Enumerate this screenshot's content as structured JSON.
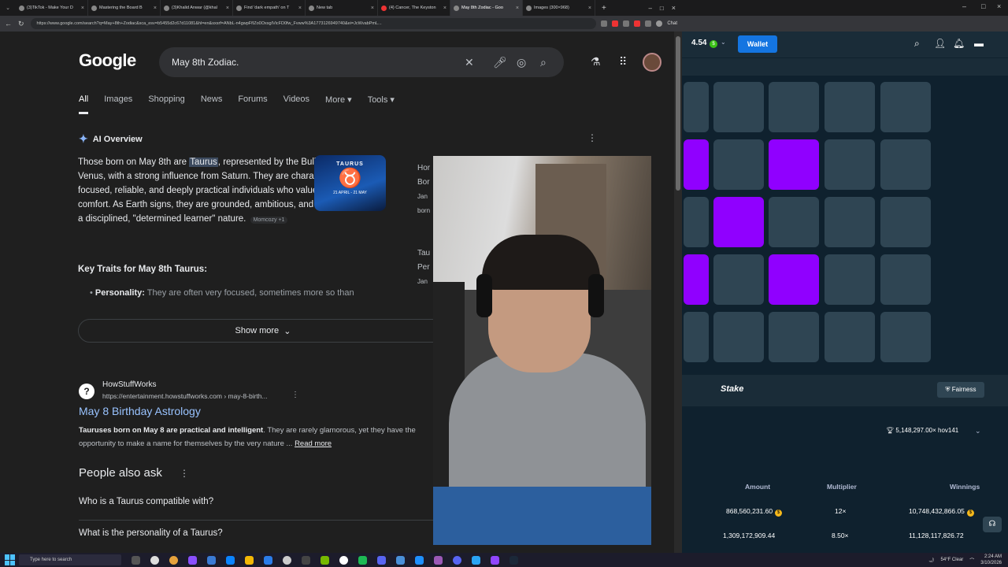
{
  "tabs": [
    {
      "label": "(3)TikTok - Make Your D"
    },
    {
      "label": "Mastering the Board B"
    },
    {
      "label": "(3)Khalid Anwar (@khal"
    },
    {
      "label": "Find 'dark empath' on T"
    },
    {
      "label": "New tab"
    },
    {
      "label": "(4) Cancer, The Keyston"
    },
    {
      "label": "May 8th Zodiac - Goo"
    },
    {
      "label": "Images (300×968)"
    }
  ],
  "address": {
    "url": "https://www.google.com/search?q=May+8th+Zodiac&sca_esv=b5455d2c67d11081&hl=en&sxsrf=ANbL-n4gwpFfIZo0OxsgIVicFD0fw_Fvww%3A1773126949740&ei=JcWvabPmL..."
  },
  "google": {
    "logo": "Google",
    "query": "May 8th Zodiac.",
    "nav_tabs": [
      "All",
      "Images",
      "Shopping",
      "News",
      "Forums",
      "Videos",
      "More",
      "Tools"
    ],
    "ai_overview": {
      "title": "AI Overview",
      "text_before": "Those born on May 8th are ",
      "highlight": "Taurus",
      "text_after": ", represented by the Bull and ruled by Venus, with a strong influence from Saturn. They are characterized as focused, reliable, and deeply practical individuals who value stability and comfort. As Earth signs, they are grounded, ambitious, and often possess a disciplined, \"determined learner\" nature.",
      "source": "Momcozy +1",
      "image_title": "TAURUS",
      "image_glyph": "♉",
      "image_dates": "21 APRIL - 21 MAY",
      "side_text": [
        "Hor",
        "Bor",
        "Jan",
        "born",
        "",
        "Tau",
        "Per",
        "Jan"
      ],
      "key_traits": "Key Traits for May 8th Taurus:",
      "personality_label": "Personality:",
      "personality_text": " They are often very focused, sometimes more so than",
      "show_more": "Show more"
    },
    "result": {
      "site": "HowStuffWorks",
      "url": "https://entertainment.howstuffworks.com › may-8-birth...",
      "title": "May 8 Birthday Astrology",
      "snippet_bold": "Tauruses born on May 8 are practical and intelligent",
      "snippet_rest": ". They are rarely glamorous, yet they have the opportunity to make a name for themselves by the very nature ...",
      "read_more": "Read more"
    },
    "paa": {
      "title": "People also ask",
      "questions": [
        "Who is a Taurus compatible with?",
        "What is the personality of a Taurus?"
      ]
    }
  },
  "stake": {
    "balance": "4.54",
    "wallet": "Wallet",
    "logo": "Stake",
    "fairness": "Fairness",
    "jackpot": "5,148,297.00× hov141",
    "headers": [
      "Amount",
      "Multiplier",
      "Winnings"
    ],
    "rows": [
      {
        "amount": "868,560,231.60",
        "multiplier": "12×",
        "winnings": "10,748,432,866.05"
      },
      {
        "amount": "1,309,172,909.44",
        "multiplier": "8.50×",
        "winnings": "11,128,117,826.72"
      }
    ],
    "gem_color": "#9000ff",
    "tile_color": "#2f4553"
  },
  "taskbar": {
    "search_placeholder": "Type here to search",
    "weather": "54°F Clear",
    "time": "2:24 AM",
    "date": "3/10/2026"
  }
}
